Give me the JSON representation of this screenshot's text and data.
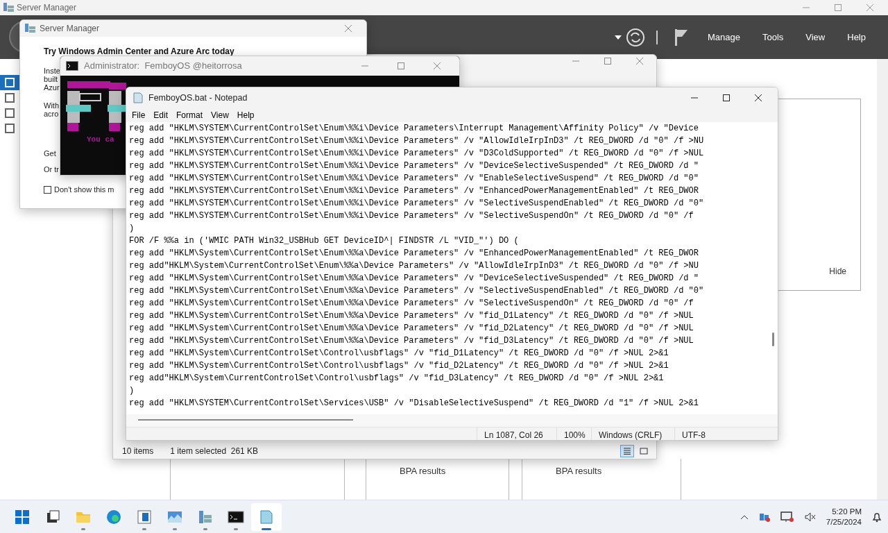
{
  "server_manager": {
    "title": "Server Manager",
    "menu": [
      "Manage",
      "Tools",
      "View",
      "Help"
    ],
    "sidebar": [
      {
        "selected": true
      },
      {
        "selected": false
      },
      {
        "selected": false
      },
      {
        "selected": false
      }
    ],
    "hide_label": "Hide",
    "tiles": [
      "BPA results",
      "BPA results"
    ]
  },
  "dialog": {
    "title": "Server Manager",
    "heading": "Try Windows Admin Center and Azure Arc today",
    "paragraphs": [
      [
        "Inste",
        "built",
        "Azur"
      ],
      [
        "With",
        "acro"
      ],
      [
        "Get"
      ],
      [
        "Or tr"
      ]
    ],
    "checkbox": {
      "label": "Don't show this m",
      "checked": false
    }
  },
  "explorer": {
    "item_count": "10 items",
    "selection": "1 item selected  261 KB",
    "views": [
      {
        "selected": true
      },
      {
        "selected": false
      }
    ]
  },
  "console": {
    "title": "Administrator:  FemboyOS @heitorrosa",
    "banner_text": "You ca"
  },
  "notepad": {
    "title": "FemboyOS.bat - Notepad",
    "menu": [
      "File",
      "Edit",
      "Format",
      "View",
      "Help"
    ],
    "lines": [
      "reg add \"HKLM\\SYSTEM\\CurrentControlSet\\Enum\\%%i\\Device Parameters\\Interrupt Management\\Affinity Policy\" /v \"Device",
      "reg add \"HKLM\\SYSTEM\\CurrentControlSet\\Enum\\%%i\\Device Parameters\" /v \"AllowIdleIrpInD3\" /t REG_DWORD /d \"0\" /f >NU",
      "reg add \"HKLM\\SYSTEM\\CurrentControlSet\\Enum\\%%i\\Device Parameters\" /v \"D3ColdSupported\" /t REG_DWORD /d \"0\" /f >NUL",
      "reg add \"HKLM\\SYSTEM\\CurrentControlSet\\Enum\\%%i\\Device Parameters\" /v \"DeviceSelectiveSuspended\" /t REG_DWORD /d \"",
      "reg add \"HKLM\\SYSTEM\\CurrentControlSet\\Enum\\%%i\\Device Parameters\" /v \"EnableSelectiveSuspend\" /t REG_DWORD /d \"0\"",
      "reg add \"HKLM\\SYSTEM\\CurrentControlSet\\Enum\\%%i\\Device Parameters\" /v \"EnhancedPowerManagementEnabled\" /t REG_DWOR",
      "reg add \"HKLM\\SYSTEM\\CurrentControlSet\\Enum\\%%i\\Device Parameters\" /v \"SelectiveSuspendEnabled\" /t REG_DWORD /d \"0\"",
      "reg add \"HKLM\\SYSTEM\\CurrentControlSet\\Enum\\%%i\\Device Parameters\" /v \"SelectiveSuspendOn\" /t REG_DWORD /d \"0\" /f",
      ")",
      "FOR /F %%a in ('WMIC PATH Win32_USBHub GET DeviceID^| FINDSTR /L \"VID_\"') DO (",
      "reg add \"HKLM\\System\\CurrentControlSet\\Enum\\%%a\\Device Parameters\" /v \"EnhancedPowerManagementEnabled\" /t REG_DWOR",
      "reg add\"HKLM\\System\\CurrentControlSet\\Enum\\%%a\\Device Parameters\" /v \"AllowIdleIrpInD3\" /t REG_DWORD /d \"0\" /f >NU",
      "reg add \"HKLM\\System\\CurrentControlSet\\Enum\\%%a\\Device Parameters\" /v \"DeviceSelectiveSuspended\" /t REG_DWORD /d \"",
      "reg add \"HKLM\\System\\CurrentControlSet\\Enum\\%%a\\Device Parameters\" /v \"SelectiveSuspendEnabled\" /t REG_DWORD /d \"0\"",
      "reg add \"HKLM\\System\\CurrentControlSet\\Enum\\%%a\\Device Parameters\" /v \"SelectiveSuspendOn\" /t REG_DWORD /d \"0\" /f",
      "reg add \"HKLM\\System\\CurrentControlSet\\Enum\\%%a\\Device Parameters\" /v \"fid_D1Latency\" /t REG_DWORD /d \"0\" /f >NUL",
      "reg add \"HKLM\\System\\CurrentControlSet\\Enum\\%%a\\Device Parameters\" /v \"fid_D2Latency\" /t REG_DWORD /d \"0\" /f >NUL",
      "reg add \"HKLM\\System\\CurrentControlSet\\Enum\\%%a\\Device Parameters\" /v \"fid_D3Latency\" /t REG_DWORD /d \"0\" /f >NUL",
      "reg add \"HKLM\\System\\CurrentControlSet\\Control\\usbflags\" /v \"fid_D1Latency\" /t REG_DWORD /d \"0\" /f >NUL 2>&1",
      "reg add \"HKLM\\System\\CurrentControlSet\\Control\\usbflags\" /v \"fid_D2Latency\" /t REG_DWORD /d \"0\" /f >NUL 2>&1",
      "reg add\"HKLM\\System\\CurrentControlSet\\Control\\usbflags\" /v \"fid_D3Latency\" /t REG_DWORD /d \"0\" /f >NUL 2>&1",
      ")",
      "reg add \"HKLM\\SYSTEM\\CurrentControlSet\\Services\\USB\" /v \"DisableSelectiveSuspend\" /t REG_DWORD /d \"1\" /f >NUL 2>&1"
    ],
    "status": [
      "Ln 1087, Col 26",
      "100%",
      "Windows (CRLF)",
      "UTF-8"
    ]
  },
  "taskbar": {
    "apps": [
      {
        "kind": "start",
        "running": false,
        "selected": false
      },
      {
        "kind": "taskview",
        "running": false,
        "selected": false
      },
      {
        "kind": "explorer",
        "running": true,
        "selected": false
      },
      {
        "kind": "edge",
        "running": false,
        "selected": false
      },
      {
        "kind": "panel",
        "running": true,
        "selected": false
      },
      {
        "kind": "monitor",
        "running": true,
        "selected": false
      },
      {
        "kind": "servermanager",
        "running": true,
        "selected": false
      },
      {
        "kind": "terminal",
        "running": true,
        "selected": false
      },
      {
        "kind": "notepad",
        "running": true,
        "selected": true
      }
    ],
    "time": "5:20 PM",
    "date": "7/25/2024"
  }
}
